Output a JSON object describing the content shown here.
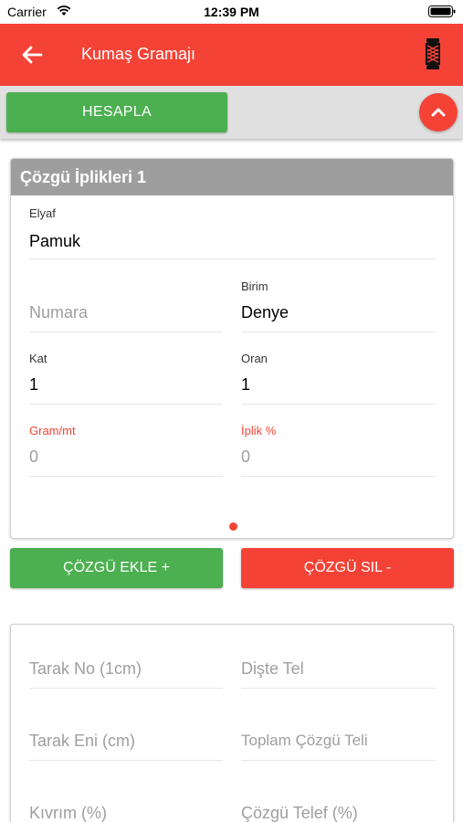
{
  "status_bar": {
    "carrier": "Carrier",
    "time": "12:39 PM"
  },
  "app_bar": {
    "title": "Kumaş Gramajı",
    "back_icon": "arrow-left-icon",
    "right_icon": "yarn-spool-icon",
    "color": "#f44336"
  },
  "actions": {
    "calculate_label": "HESAPLA",
    "collapse_icon": "chevron-up-icon"
  },
  "warp_card": {
    "title": "Çözgü İplikleri 1",
    "fiber": {
      "label": "Elyaf",
      "value": "Pamuk"
    },
    "count": {
      "placeholder": "Numara"
    },
    "unit": {
      "label": "Birim",
      "value": "Denye"
    },
    "ply": {
      "label": "Kat",
      "value": "1"
    },
    "ratio": {
      "label": "Oran",
      "value": "1"
    },
    "gram_per_meter": {
      "label": "Gram/mt",
      "value": "0"
    },
    "yarn_percent": {
      "label": "İplik %",
      "value": "0"
    }
  },
  "warp_buttons": {
    "add_label": "ÇÖZGÜ EKLE +",
    "remove_label": "ÇÖZGÜ SIL -"
  },
  "loom_card": {
    "reed_no": {
      "placeholder": "Tarak No (1cm)"
    },
    "ends_per_dent": {
      "placeholder": "Dişte Tel"
    },
    "reed_width": {
      "placeholder": "Tarak Eni (cm)"
    },
    "total_warp_ends": {
      "placeholder": "Toplam Çözgü Teli"
    },
    "crimp": {
      "placeholder": "Kıvrım (%)"
    },
    "warp_waste": {
      "placeholder": "Çözgü Telef (%)"
    }
  },
  "colors": {
    "primary_red": "#f44336",
    "primary_green": "#4caf50",
    "header_gray": "#9e9e9e"
  }
}
